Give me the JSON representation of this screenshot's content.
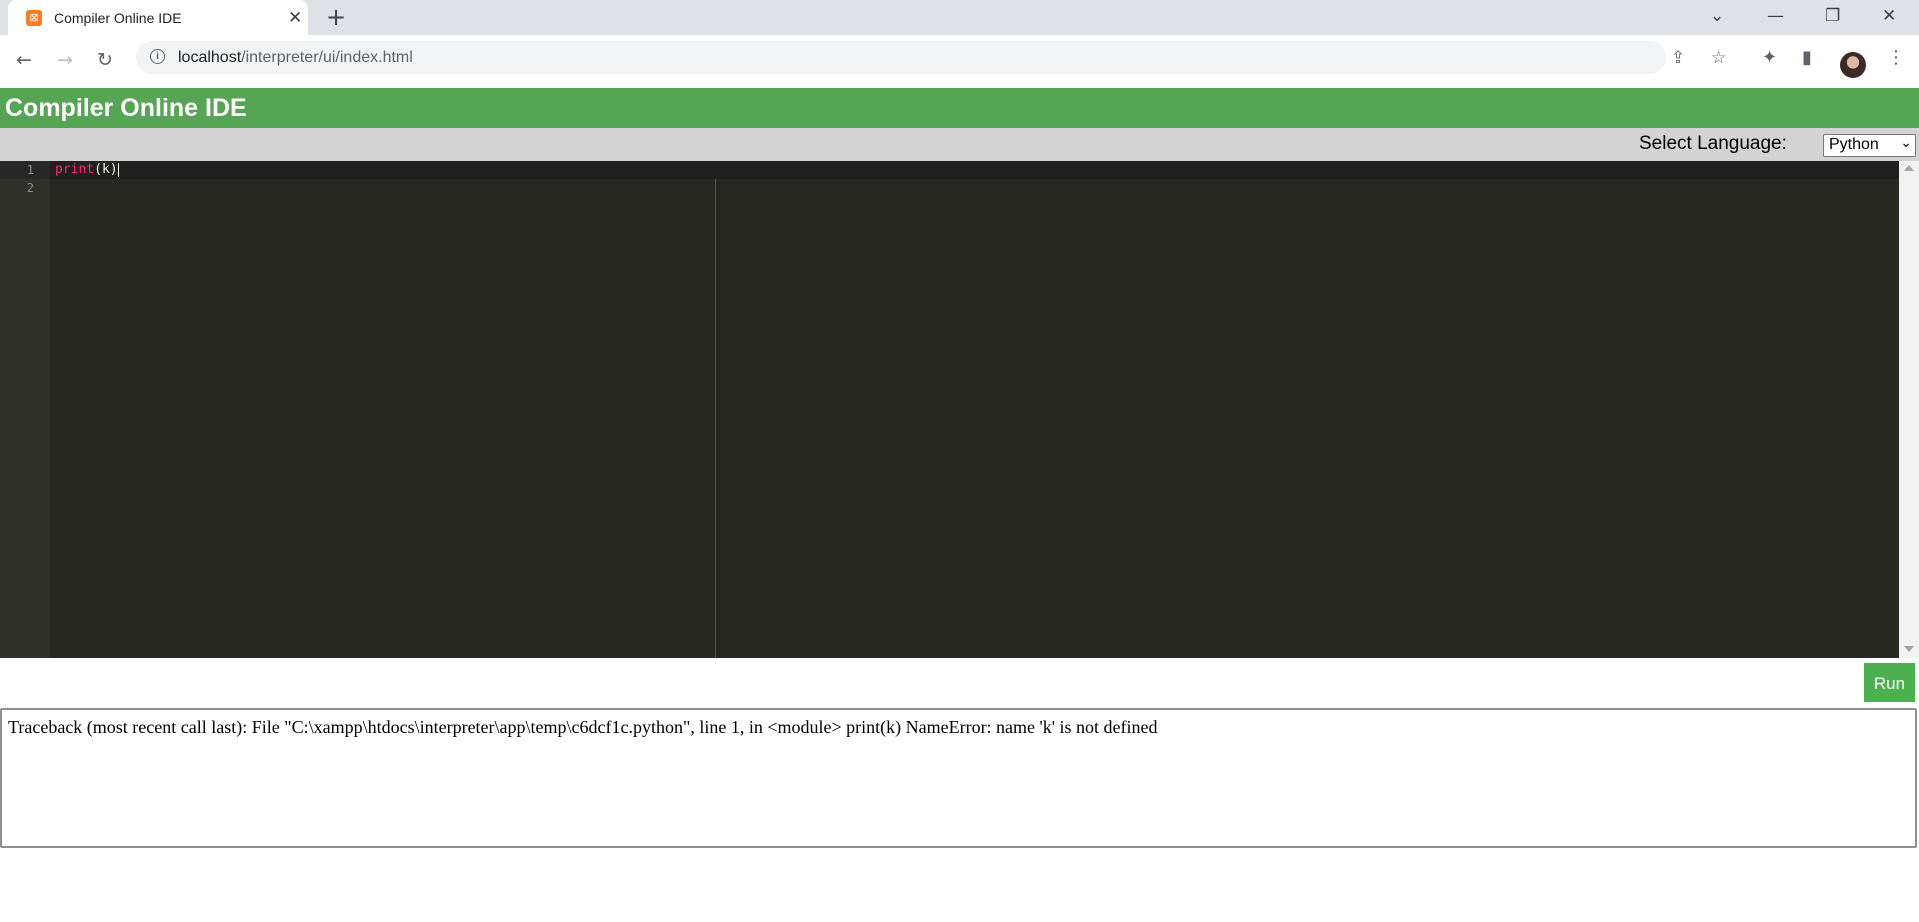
{
  "browser": {
    "tab_title": "Compiler Online IDE",
    "tab_close": "✕",
    "new_tab": "+",
    "url_host": "localhost",
    "url_path": "/interpreter/ui/index.html",
    "window_controls": {
      "tab_search": "⌄",
      "minimize": "—",
      "restore": "❐",
      "close": "✕"
    }
  },
  "app": {
    "title": "Compiler Online IDE",
    "language_label": "Select Language:",
    "language_selected": "Python",
    "run_label": "Run",
    "colors": {
      "header": "#55a555",
      "editor_bg": "#272822",
      "run": "#4caf50"
    }
  },
  "editor": {
    "line_numbers": [
      "1",
      "2"
    ],
    "lines": [
      {
        "keyword": "print",
        "rest": "(k)"
      },
      {
        "keyword": "",
        "rest": ""
      }
    ]
  },
  "output": {
    "text": "Traceback (most recent call last): File \"C:\\xampp\\htdocs\\interpreter\\app\\temp\\c6dcf1c.python\", line 1, in <module> print(k) NameError: name 'k' is not defined"
  }
}
